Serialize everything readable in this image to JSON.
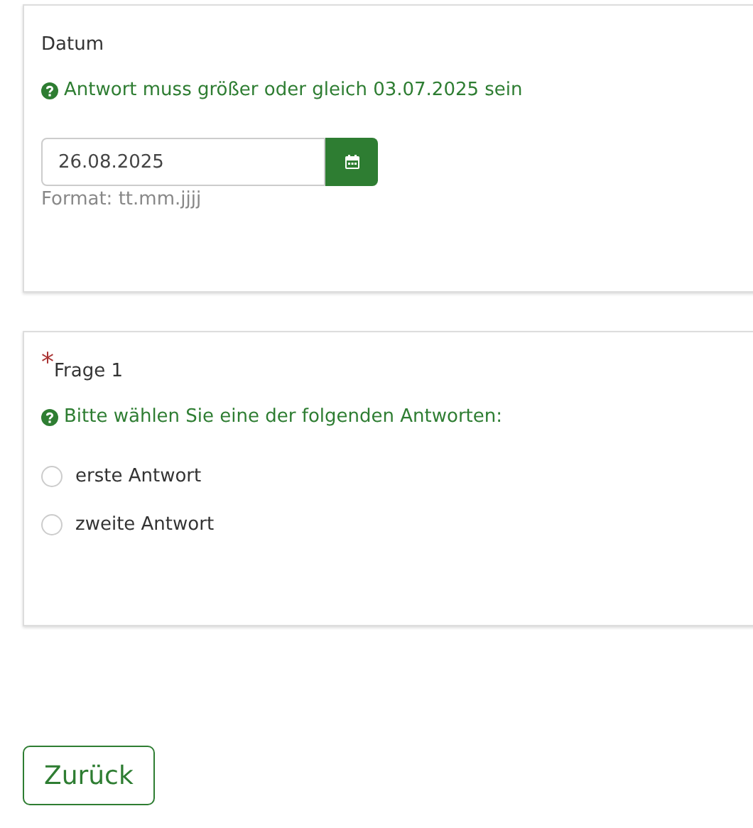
{
  "questions": [
    {
      "kind": "date",
      "label": "Datum",
      "help": "Antwort muss größer oder gleich 03.07.2025 sein",
      "value": "26.08.2025",
      "format_hint": "Format: tt.mm.jjjj"
    },
    {
      "kind": "radio",
      "required_mark": "*",
      "label": "Frage 1",
      "help": "Bitte wählen Sie eine der folgenden Antworten:",
      "options": [
        {
          "label": "erste Antwort",
          "selected": false
        },
        {
          "label": "zweite Antwort",
          "selected": false
        }
      ]
    }
  ],
  "back_button": "Zurück"
}
